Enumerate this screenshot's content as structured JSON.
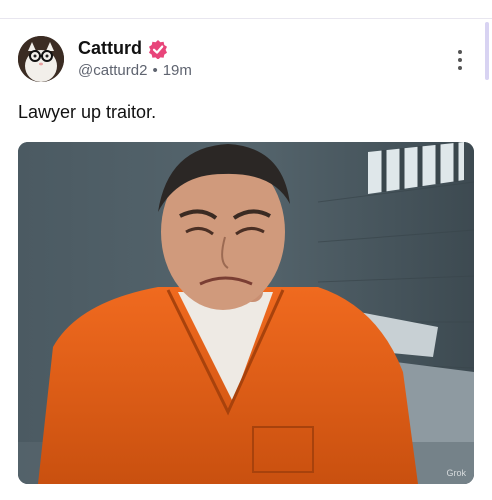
{
  "post": {
    "author_name": "Catturd",
    "handle": "@catturd2",
    "separator": "•",
    "time": "19m",
    "text": "Lawyer up traitor.",
    "image_watermark": "Grok"
  },
  "icons": {
    "verified": "verified-badge-icon",
    "more": "more-vertical-icon"
  },
  "colors": {
    "verified_badge": "#e8457a",
    "handle_text": "#5f6470"
  }
}
